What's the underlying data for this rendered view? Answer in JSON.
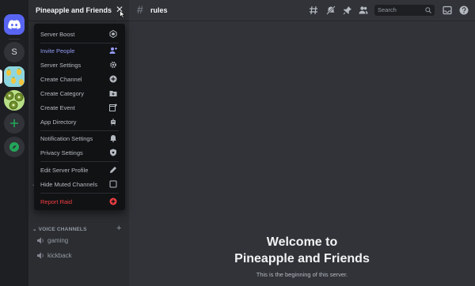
{
  "window": {
    "traffic_lights": {
      "close": "#ed6a5e",
      "minimize": "#f5bf4f",
      "zoom": "#61c554"
    }
  },
  "server_rail": {
    "home_icon": "discord-logo-icon",
    "items": [
      {
        "type": "letter",
        "label": "S"
      },
      {
        "type": "image",
        "icon": "pineapple-pattern-icon"
      },
      {
        "type": "image",
        "icon": "kiwi-pattern-icon"
      },
      {
        "type": "action",
        "icon": "plus-icon"
      },
      {
        "type": "action",
        "icon": "compass-icon"
      }
    ],
    "accent_green": "#23a559"
  },
  "sidebar": {
    "server_name": "Pineapple and Friends",
    "close_icon": "close-icon",
    "categories": [
      {
        "label": "VOICE CHANNELS",
        "channels": [
          "gaming",
          "kickback"
        ]
      }
    ]
  },
  "menu": {
    "items": [
      {
        "label": "Server Boost",
        "icon": "boost-gem-icon",
        "color": "#b5bac1"
      },
      {
        "label": "Invite People",
        "icon": "add-person-icon",
        "color": "#949cf7"
      },
      {
        "label": "Server Settings",
        "icon": "gear-icon",
        "color": "#b5bac1"
      },
      {
        "label": "Create Channel",
        "icon": "plus-circle-icon",
        "color": "#b5bac1"
      },
      {
        "label": "Create Category",
        "icon": "folder-plus-icon",
        "color": "#b5bac1"
      },
      {
        "label": "Create Event",
        "icon": "calendar-plus-icon",
        "color": "#b5bac1"
      },
      {
        "label": "App Directory",
        "icon": "robot-icon",
        "color": "#b5bac1"
      },
      {
        "label": "Notification Settings",
        "icon": "bell-icon",
        "color": "#b5bac1"
      },
      {
        "label": "Privacy Settings",
        "icon": "shield-icon",
        "color": "#b5bac1"
      },
      {
        "label": "Edit Server Profile",
        "icon": "pencil-icon",
        "color": "#b5bac1"
      },
      {
        "label": "Hide Muted Channels",
        "icon": "checkbox-icon",
        "color": "#b5bac1"
      },
      {
        "label": "Report Raid",
        "icon": "alert-shield-icon",
        "color": "#f23f43"
      }
    ]
  },
  "header": {
    "channel_name": "rules",
    "icons": [
      "threads-icon",
      "mute-bell-icon",
      "pin-icon",
      "members-icon"
    ],
    "search_placeholder": "Search",
    "right_icons": [
      "inbox-icon",
      "help-icon"
    ]
  },
  "main": {
    "welcome_line1": "Welcome to",
    "welcome_line2": "Pineapple and Friends",
    "subtitle": "This is the beginning of this server."
  }
}
